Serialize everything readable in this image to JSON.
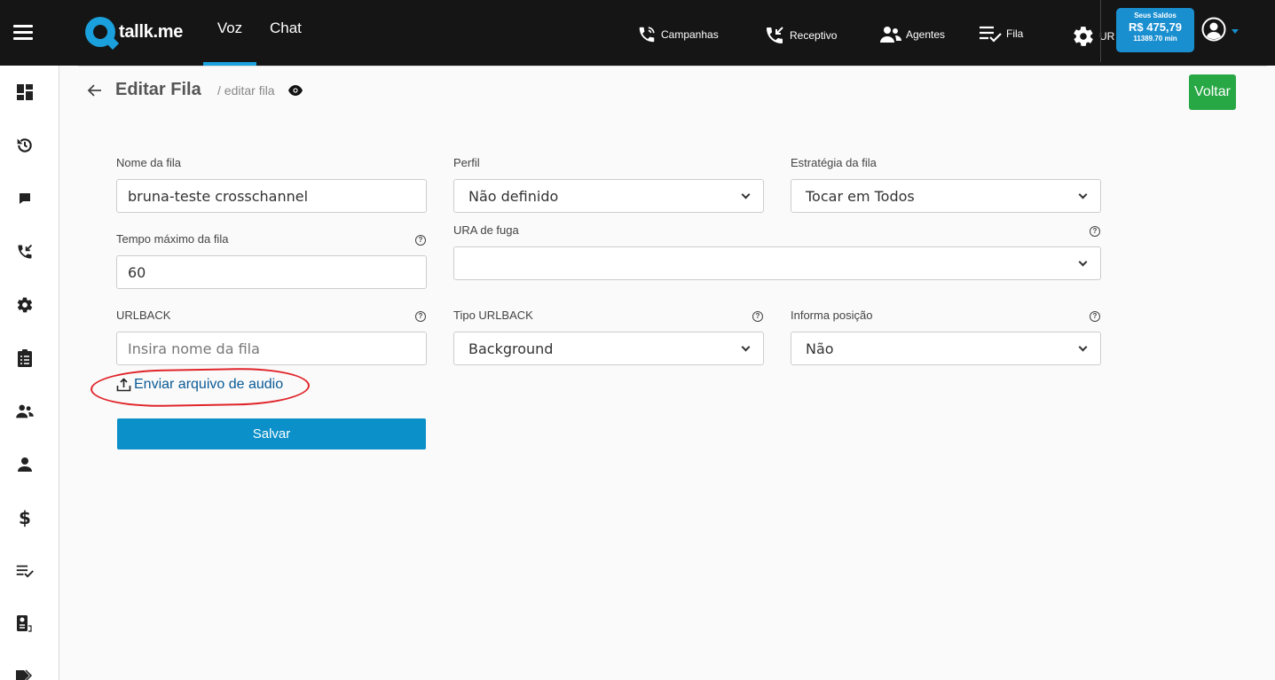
{
  "brand": {
    "name": "tallk.me",
    "accent": "#1aa0dc"
  },
  "top_tabs": [
    {
      "label": "Voz",
      "active": true
    },
    {
      "label": "Chat",
      "active": false
    }
  ],
  "top_menu": {
    "campanhas": "Campanhas",
    "receptivo": "Receptivo",
    "agentes": "Agentes",
    "fila": "Fila",
    "ura": "UR"
  },
  "balance": {
    "title": "Seus Saldos",
    "amount": "R$ 475,79",
    "minutes": "11389.70 min"
  },
  "header": {
    "title": "Editar Fila",
    "breadcrumb": "/ editar fila",
    "back_button_label": "Voltar"
  },
  "form": {
    "nome": {
      "label": "Nome da fila",
      "value": "bruna-teste crosschannel"
    },
    "perfil": {
      "label": "Perfil",
      "value": "Não definido"
    },
    "estrategia": {
      "label": "Estratégia da fila",
      "value": "Tocar em Todos"
    },
    "tempo": {
      "label": "Tempo máximo da fila",
      "value": "60"
    },
    "ura": {
      "label": "URA de fuga",
      "value": ""
    },
    "urlback": {
      "label": "URLBACK",
      "placeholder": "Insira nome da fila"
    },
    "tipo_urlback": {
      "label": "Tipo URLBACK",
      "value": "Background"
    },
    "informa": {
      "label": "Informa posição",
      "value": "Não"
    },
    "upload_label": "Enviar arquivo de audio",
    "save_label": "Salvar"
  },
  "sidebar_icons": [
    "dashboard-icon",
    "history-icon",
    "chat-icon",
    "incoming-call-icon",
    "settings-icon",
    "clipboard-icon",
    "agents-icon",
    "user-icon",
    "dollar-icon",
    "queue-icon",
    "billing-icon",
    "tags-icon"
  ],
  "colors": {
    "topbar": "#151515",
    "primary": "#0b90c9",
    "success": "#28a745",
    "annotation": "#e0252a"
  }
}
